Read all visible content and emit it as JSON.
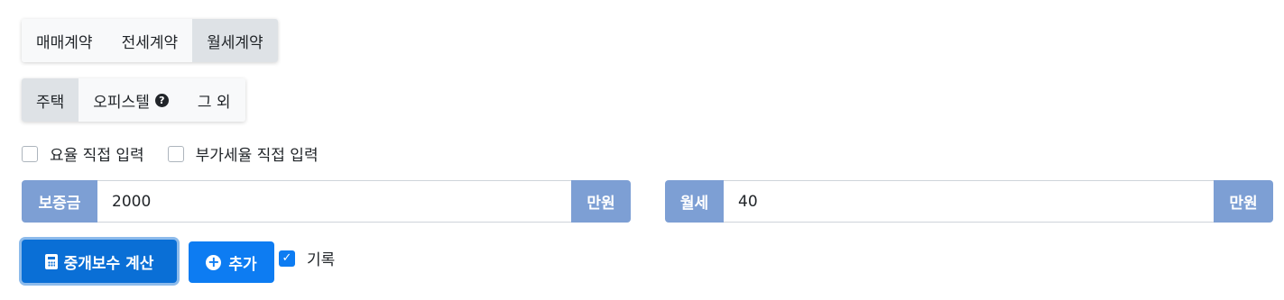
{
  "contract_types": [
    {
      "label": "매매계약",
      "active": false
    },
    {
      "label": "전세계약",
      "active": false
    },
    {
      "label": "월세계약",
      "active": true
    }
  ],
  "property_types": [
    {
      "label": "주택",
      "active": true
    },
    {
      "label": "오피스텔",
      "active": false,
      "help_icon": "question-circle-icon"
    },
    {
      "label": "그 외",
      "active": false
    }
  ],
  "options": {
    "rate_direct_input": {
      "label": "요율 직접 입력",
      "checked": false
    },
    "vat_direct_input": {
      "label": "부가세율 직접 입력",
      "checked": false
    }
  },
  "deposit": {
    "label": "보증금",
    "value": "2000",
    "unit": "만원"
  },
  "monthly_rent": {
    "label": "월세",
    "value": "40",
    "unit": "만원"
  },
  "actions": {
    "calculate_label": "중개보수 계산",
    "add_label": "추가",
    "record_label": "기록",
    "record_checked": true
  },
  "colors": {
    "addon": "#7d9fd4",
    "primary": "#0d7cf2",
    "primary_dark": "#0a6fd6",
    "segment_bg": "#f8f9fa",
    "segment_active": "#dee2e6"
  }
}
